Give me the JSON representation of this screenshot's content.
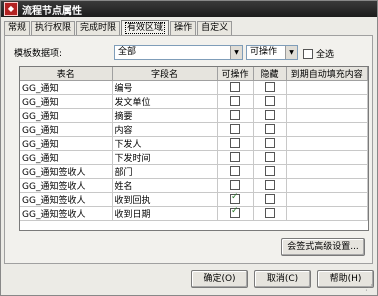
{
  "window": {
    "title": "流程节点属性",
    "icon": "app-icon"
  },
  "tabs": [
    {
      "label": "常规"
    },
    {
      "label": "执行权限"
    },
    {
      "label": "完成时限"
    },
    {
      "label": "有效区域"
    },
    {
      "label": "操作"
    },
    {
      "label": "自定义"
    }
  ],
  "active_tab": "有效区域",
  "filter": {
    "label": "模板数据项:",
    "scope_value": "全部",
    "mode_value": "可操作",
    "select_all_label": "全选",
    "select_all_checked": false
  },
  "grid": {
    "headers": [
      "表名",
      "字段名",
      "可操作",
      "隐藏",
      "到期自动填充内容"
    ],
    "rows": [
      {
        "table": "GG_通知",
        "field": "编号",
        "operable": false,
        "hidden": false,
        "autofill": ""
      },
      {
        "table": "GG_通知",
        "field": "发文单位",
        "operable": false,
        "hidden": false,
        "autofill": ""
      },
      {
        "table": "GG_通知",
        "field": "摘要",
        "operable": false,
        "hidden": false,
        "autofill": ""
      },
      {
        "table": "GG_通知",
        "field": "内容",
        "operable": false,
        "hidden": false,
        "autofill": ""
      },
      {
        "table": "GG_通知",
        "field": "下发人",
        "operable": false,
        "hidden": false,
        "autofill": ""
      },
      {
        "table": "GG_通知",
        "field": "下发时间",
        "operable": false,
        "hidden": false,
        "autofill": ""
      },
      {
        "table": "GG_通知签收人",
        "field": "部门",
        "operable": false,
        "hidden": false,
        "autofill": ""
      },
      {
        "table": "GG_通知签收人",
        "field": "姓名",
        "operable": false,
        "hidden": false,
        "autofill": ""
      },
      {
        "table": "GG_通知签收人",
        "field": "收到回执",
        "operable": true,
        "hidden": false,
        "autofill": ""
      },
      {
        "table": "GG_通知签收人",
        "field": "收到日期",
        "operable": true,
        "hidden": false,
        "autofill": ""
      }
    ]
  },
  "buttons": {
    "advanced": "会签式高级设置...",
    "ok": "确定(O)",
    "cancel": "取消(C)",
    "help": "帮助(H)"
  }
}
